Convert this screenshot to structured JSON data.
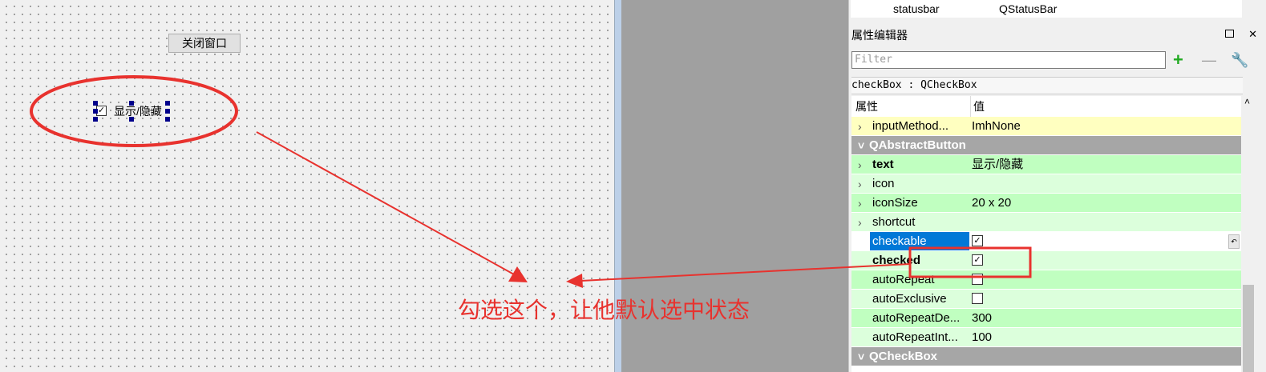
{
  "designer": {
    "close_button": "关闭窗口",
    "checkbox_label": "显示/隐藏",
    "checkbox_mark": "✓"
  },
  "object_row": {
    "name": "statusbar",
    "class": "QStatusBar"
  },
  "property_editor": {
    "title": "属性编辑器",
    "restore_icon": "restore-icon",
    "close_glyph": "✕",
    "filter_placeholder": "Filter",
    "add_glyph": "+",
    "remove_glyph": "—",
    "configure_glyph": "🔧",
    "object_label": "checkBox : QCheckBox",
    "col_property": "属性",
    "col_value": "值",
    "rows": [
      {
        "name": "inputMethod...",
        "value": "ImhNone",
        "arrow": "›"
      },
      {
        "name": "QAbstractButton"
      },
      {
        "name": "text",
        "value": "显示/隐藏",
        "arrow": "›"
      },
      {
        "name": "icon",
        "value": "",
        "arrow": "›"
      },
      {
        "name": "iconSize",
        "value": "20 x 20",
        "arrow": "›"
      },
      {
        "name": "shortcut",
        "value": "",
        "arrow": "›"
      },
      {
        "name": "checkable",
        "value": "✓"
      },
      {
        "name": "checked",
        "value": "✓"
      },
      {
        "name": "autoRepeat",
        "value": ""
      },
      {
        "name": "autoExclusive",
        "value": ""
      },
      {
        "name": "autoRepeatDe...",
        "value": "300"
      },
      {
        "name": "autoRepeatInt...",
        "value": "100"
      },
      {
        "name": "QCheckBox"
      }
    ]
  },
  "annotation": "勾选这个，让他默认选中状态",
  "colors": {
    "annotation": "#e8322e",
    "selection": "#0078d7"
  }
}
